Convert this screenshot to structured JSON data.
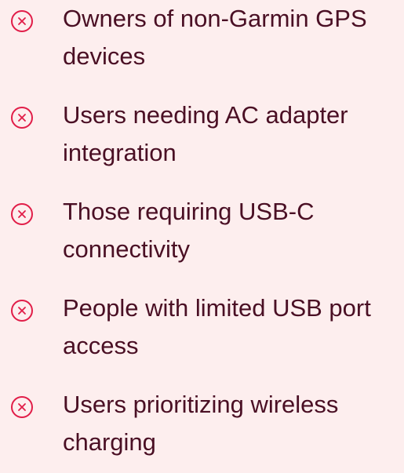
{
  "list": {
    "items": [
      {
        "icon": "x-circle-icon",
        "text": "Owners of non-Garmin GPS devices"
      },
      {
        "icon": "x-circle-icon",
        "text": "Users needing AC adapter integration"
      },
      {
        "icon": "x-circle-icon",
        "text": "Those requiring USB-C connectivity"
      },
      {
        "icon": "x-circle-icon",
        "text": "People with limited USB port access"
      },
      {
        "icon": "x-circle-icon",
        "text": "Users prioritizing wireless charging"
      }
    ]
  },
  "colors": {
    "background": "#fdeeee",
    "text": "#4a0f24",
    "icon": "#e11d48"
  }
}
